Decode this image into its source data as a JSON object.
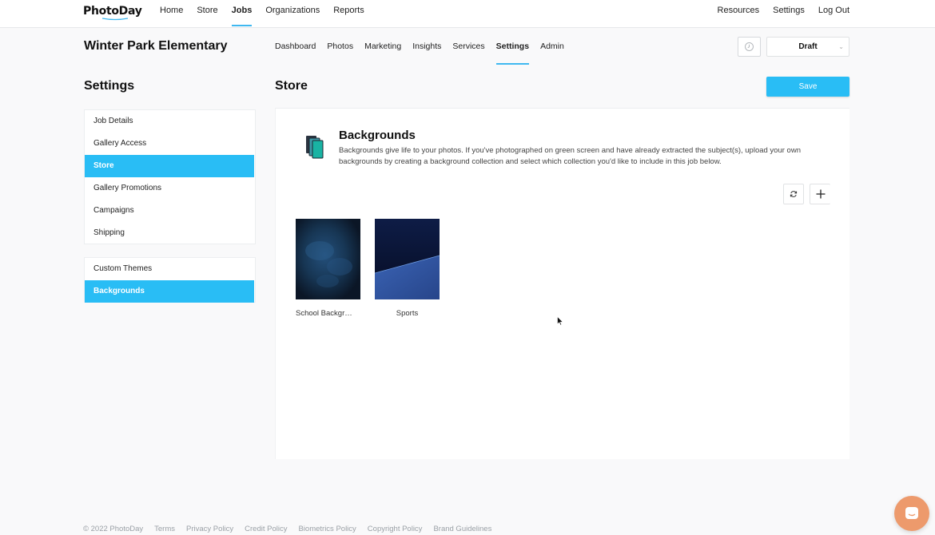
{
  "app": {
    "logo": "PhotoDay"
  },
  "topnav": {
    "left": [
      "Home",
      "Store",
      "Jobs",
      "Organizations",
      "Reports"
    ],
    "active": "Jobs",
    "right": [
      "Resources",
      "Settings",
      "Log Out"
    ]
  },
  "job": {
    "title": "Winter Park Elementary",
    "tabs": [
      "Dashboard",
      "Photos",
      "Marketing",
      "Insights",
      "Services",
      "Settings",
      "Admin"
    ],
    "active_tab": "Settings",
    "status": "Draft"
  },
  "settings": {
    "heading": "Settings",
    "group1": [
      "Job Details",
      "Gallery Access",
      "Store",
      "Gallery Promotions",
      "Campaigns",
      "Shipping"
    ],
    "group2": [
      "Custom Themes",
      "Backgrounds"
    ],
    "selected": [
      "Store",
      "Backgrounds"
    ]
  },
  "store": {
    "heading": "Store",
    "save_label": "Save",
    "section_title": "Backgrounds",
    "section_desc": "Backgrounds give life to your photos. If you've photographed on green screen and have already extracted the subject(s), upload your own backgrounds by creating a background collection and select which collection you'd like to include in this job below.",
    "collections": [
      {
        "name": "School Backgr…",
        "icon": "collection-thumb-dark-blue-cloud"
      },
      {
        "name": "Sports",
        "icon": "collection-thumb-blue-diagonal"
      }
    ]
  },
  "footer": [
    "© 2022 PhotoDay",
    "Terms",
    "Privacy Policy",
    "Credit Policy",
    "Biometrics Policy",
    "Copyright Policy",
    "Brand Guidelines"
  ],
  "colors": {
    "accent": "#29bdf5",
    "chat": "#ed9a6c"
  }
}
